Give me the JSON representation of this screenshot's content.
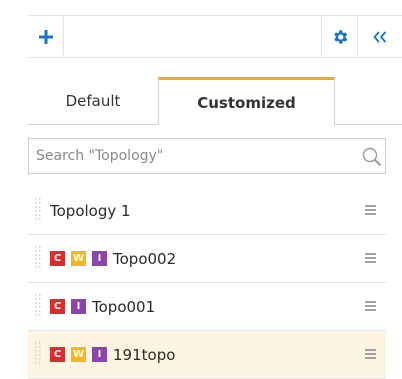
{
  "toolbar": {
    "add_icon": "plus-icon",
    "settings_icon": "gear-icon",
    "collapse_icon": "double-chevron-left-icon",
    "accent_color": "#1a73c8"
  },
  "tabs": [
    {
      "label": "Default",
      "active": false
    },
    {
      "label": "Customized",
      "active": true
    }
  ],
  "active_tab_color": "#f0a81f",
  "search": {
    "placeholder": "Search \"Topology\"",
    "value": "",
    "icon": "magnifier-icon"
  },
  "badge_colors": {
    "C": "#e02b2b",
    "W": "#f3b91c",
    "I": "#8e44ad"
  },
  "topologies": [
    {
      "name": "Topology 1",
      "badges": [],
      "highlighted": false
    },
    {
      "name": "Topo002",
      "badges": [
        "C",
        "W",
        "I"
      ],
      "highlighted": false
    },
    {
      "name": "Topo001",
      "badges": [
        "C",
        "I"
      ],
      "highlighted": false
    },
    {
      "name": "191topo",
      "badges": [
        "C",
        "W",
        "I"
      ],
      "highlighted": true
    }
  ],
  "highlight_color": "#fdf5e2"
}
